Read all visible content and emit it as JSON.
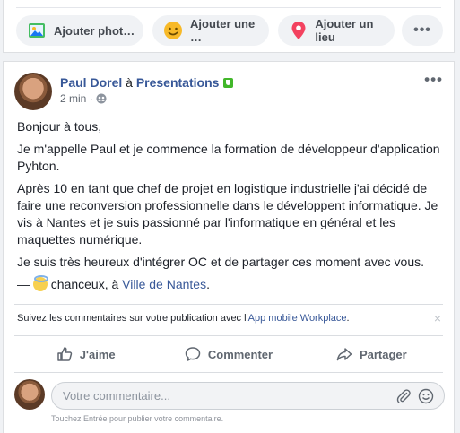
{
  "composer": {
    "photo_label": "Ajouter phot…",
    "feeling_label": "Ajouter une …",
    "place_label": "Ajouter un lieu",
    "more_label": "•••"
  },
  "post": {
    "author": "Paul Dorel",
    "connector": " à ",
    "group": "Presentations",
    "time": "2 min ·",
    "more_label": "•••",
    "paragraphs": [
      "Bonjour à tous,",
      "Je m'appelle Paul et je commence la formation de développeur d'application Pyhton.",
      "Après 10 en tant que chef de projet en logistique industrielle j'ai décidé de faire une reconversion professionnelle dans le développent informatique. Je vis à Nantes et je suis passionné par l'informatique en général et les maquettes numérique.",
      "Je suis très heureux d'intégrer OC et de partager ces moment avec vous."
    ],
    "feeling_prefix": "— ",
    "feeling_text": " chanceux, à ",
    "feeling_place": "Ville de Nantes",
    "feeling_suffix": "."
  },
  "follow": {
    "text": "Suivez les commentaires sur votre publication avec l'",
    "link": "App mobile Workplace",
    "suffix": ".",
    "close": "×"
  },
  "actions": {
    "like": "J'aime",
    "comment": "Commenter",
    "share": "Partager"
  },
  "comment": {
    "placeholder": "Votre commentaire...",
    "hint": "Touchez Entrée pour publier votre commentaire."
  },
  "colors": {
    "link": "#385898",
    "badge_green": "#42b72a",
    "page_bg": "#f0f2f5"
  }
}
